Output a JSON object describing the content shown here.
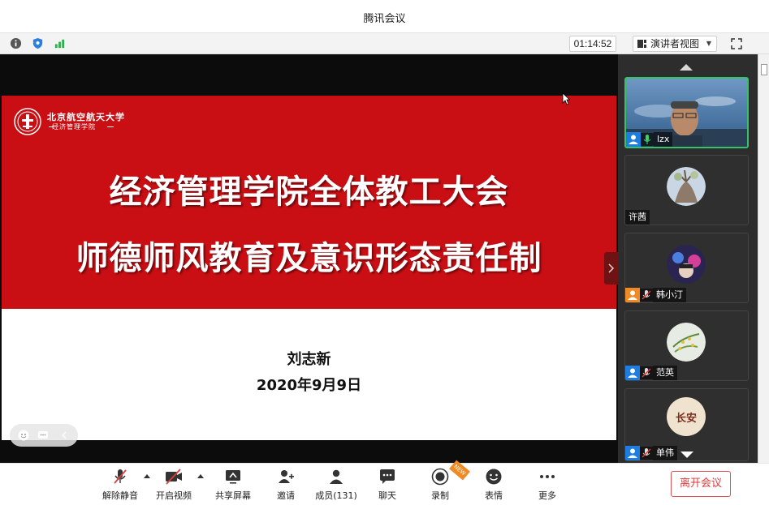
{
  "window": {
    "title": "腾讯会议"
  },
  "infobar": {
    "icons": [
      "info-icon",
      "shield-icon",
      "signal-icon"
    ],
    "timer": "01:14:52",
    "view_mode": "演讲者视图",
    "fullscreen_icon": "fullscreen-icon"
  },
  "slide": {
    "university_name": "北京航空航天大学",
    "school_name": "经济管理学院",
    "headline_1": "经济管理学院全体教工大会",
    "headline_2": "师德师风教育及意识形态责任制",
    "author": "刘志新",
    "date": "2020年9月9日"
  },
  "participants": [
    {
      "name": "lzx",
      "video": true,
      "mic": "on"
    },
    {
      "name": "许茜",
      "video": false,
      "mic": "none"
    },
    {
      "name": "韩小汀",
      "video": false,
      "mic": "muted"
    },
    {
      "name": "范英",
      "video": false,
      "mic": "muted"
    },
    {
      "name": "单伟",
      "video": false,
      "mic": "muted",
      "avatar_text": "长安"
    }
  ],
  "toolbar": {
    "mute": "解除静音",
    "video": "开启视频",
    "share": "共享屏幕",
    "invite": "邀请",
    "members": "成员(131)",
    "chat": "聊天",
    "record": "录制",
    "record_badge": "NEW",
    "emoji": "表情",
    "more": "更多",
    "leave": "离开会议"
  },
  "colors": {
    "slide_red": "#c90f14",
    "active_speaker_border": "#35c26b",
    "leave_red": "#e03b3b",
    "user_icon_blue": "#1e7de0",
    "user_icon_orange": "#f08a24"
  }
}
